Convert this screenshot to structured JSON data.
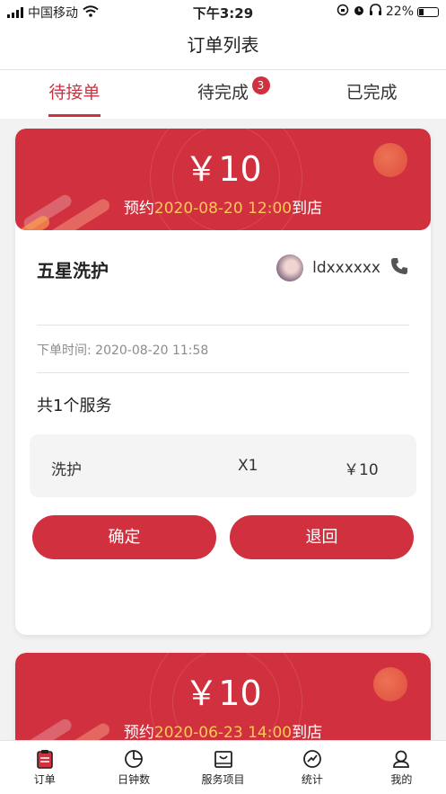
{
  "status": {
    "carrier": "中国移动",
    "time": "下午3:29",
    "battery": "22%"
  },
  "navbar": {
    "title": "订单列表"
  },
  "tabs": [
    {
      "label": "待接单",
      "active": true
    },
    {
      "label": "待完成",
      "badge": "3"
    },
    {
      "label": "已完成"
    }
  ],
  "orders": [
    {
      "price": "￥10",
      "appoint_prefix": "预约",
      "appoint_time": "2020-08-20 12:00",
      "appoint_suffix": "到店",
      "shop": "五星洗护",
      "username": "ldxxxxxx",
      "order_time": "下单时间: 2020-08-20 11:58",
      "service_count": "共1个服务",
      "service": {
        "name": "洗护",
        "qty": "X1",
        "price": "￥10"
      },
      "confirm_label": "确定",
      "reject_label": "退回"
    },
    {
      "price": "￥10",
      "appoint_prefix": "预约",
      "appoint_time": "2020-06-23 14:00",
      "appoint_suffix": "到店"
    }
  ],
  "tabbar": [
    {
      "label": "订单",
      "icon": "order-icon"
    },
    {
      "label": "日钟数",
      "icon": "pie-chart-icon"
    },
    {
      "label": "服务项目",
      "icon": "shop-bag-icon"
    },
    {
      "label": "统计",
      "icon": "trend-icon"
    },
    {
      "label": "我的",
      "icon": "profile-icon"
    }
  ],
  "colors": {
    "accent": "#d1303f",
    "highlight": "#ffc857"
  }
}
